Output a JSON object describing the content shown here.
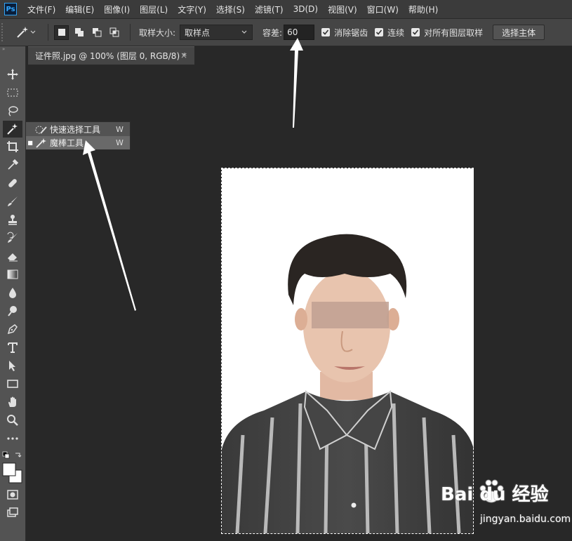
{
  "app": {
    "logo": "Ps"
  },
  "menu": [
    "文件(F)",
    "编辑(E)",
    "图像(I)",
    "图层(L)",
    "文字(Y)",
    "选择(S)",
    "滤镜(T)",
    "3D(D)",
    "视图(V)",
    "窗口(W)",
    "帮助(H)"
  ],
  "options": {
    "sample_size_label": "取样大小:",
    "sample_size_value": "取样点",
    "tolerance_label": "容差:",
    "tolerance_value": "60",
    "anti_alias_label": "消除锯齿",
    "contiguous_label": "连续",
    "sample_all_layers_label": "对所有图层取样",
    "select_subject_label": "选择主体"
  },
  "document_tab": {
    "title": "证件照.jpg @ 100% (图层 0, RGB/8) *",
    "close": "×"
  },
  "flyout": {
    "items": [
      {
        "label": "快速选择工具",
        "key": "W",
        "icon": "quick-selection-icon",
        "selected": false
      },
      {
        "label": "魔棒工具",
        "key": "W",
        "icon": "magic-wand-icon",
        "selected": true
      }
    ]
  },
  "toolbar": {
    "collapse": "»",
    "tools": [
      "move-icon",
      "marquee-icon",
      "lasso-icon",
      "magic-wand-icon",
      "crop-icon",
      "eyedropper-icon",
      "healing-icon",
      "brush-icon",
      "stamp-icon",
      "history-brush-icon",
      "eraser-icon",
      "gradient-icon",
      "blur-icon",
      "dodge-icon",
      "pen-icon",
      "type-icon",
      "path-select-icon",
      "rectangle-icon",
      "hand-icon",
      "zoom-icon",
      "more-icon",
      "color-swatches",
      "quick-mask-icon",
      "screen-mode-icon"
    ]
  },
  "watermark": {
    "brand": "Bai du 经验",
    "url": "jingyan.baidu.com"
  },
  "colors": {
    "accent": "#31a8ff",
    "panel": "#535353",
    "canvas": "#282828"
  }
}
